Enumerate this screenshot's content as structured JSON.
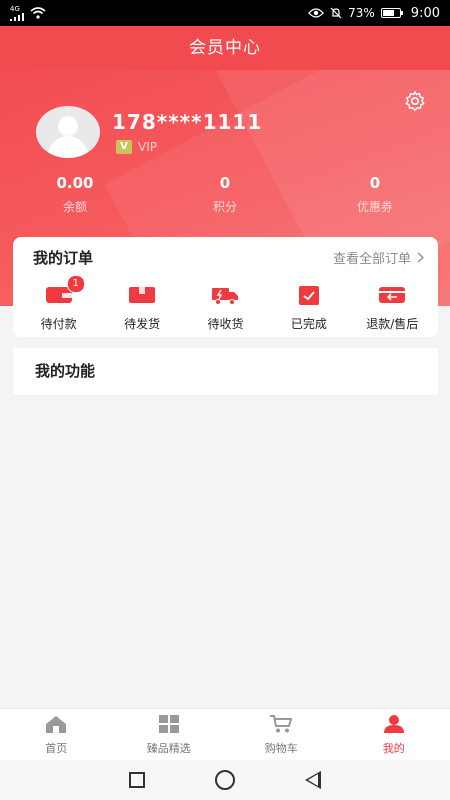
{
  "status_bar": {
    "network": "4G",
    "battery_percent": "73%",
    "time": "9:00"
  },
  "header": {
    "title": "会员中心"
  },
  "profile": {
    "phone": "178****1111",
    "vip_label": "VIP",
    "vip_badge": "V"
  },
  "stats": [
    {
      "value": "0.00",
      "label": "余额"
    },
    {
      "value": "0",
      "label": "积分"
    },
    {
      "value": "0",
      "label": "优惠券"
    }
  ],
  "orders": {
    "title": "我的订单",
    "view_all": "查看全部订单",
    "items": [
      {
        "label": "待付款",
        "badge": "1",
        "icon": "wallet-icon"
      },
      {
        "label": "待发货",
        "icon": "package-icon"
      },
      {
        "label": "待收货",
        "icon": "truck-icon"
      },
      {
        "label": "已完成",
        "icon": "clipboard-check-icon"
      },
      {
        "label": "退款/售后",
        "icon": "refund-icon"
      }
    ]
  },
  "functions": {
    "title": "我的功能"
  },
  "tabbar": [
    {
      "label": "首页",
      "icon": "home-icon"
    },
    {
      "label": "臻品精选",
      "icon": "grid-icon"
    },
    {
      "label": "购物车",
      "icon": "cart-icon"
    },
    {
      "label": "我的",
      "icon": "user-icon",
      "active": true
    }
  ],
  "colors": {
    "accent": "#ef3b3f",
    "header_bg": "#f14a4f"
  }
}
